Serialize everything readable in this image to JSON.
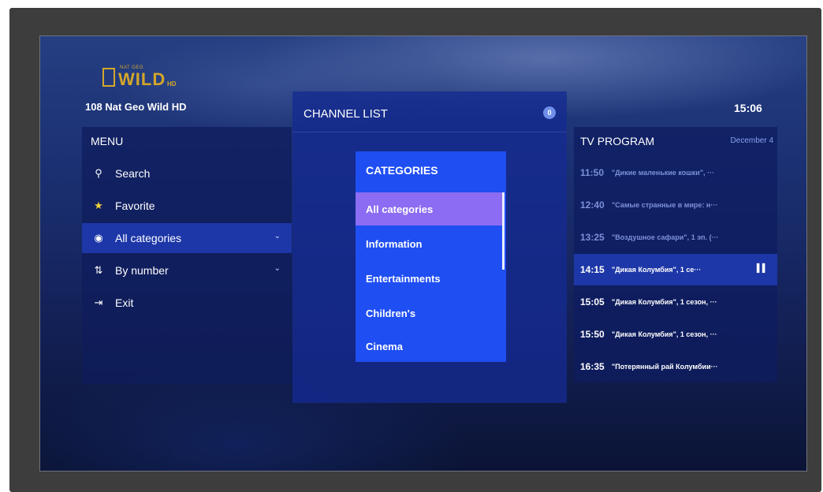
{
  "channel": {
    "number": "108",
    "name": "Nat Geo Wild HD",
    "logo_top": "NAT GEO",
    "logo_main": "WILD",
    "logo_hd": "HD"
  },
  "clock": "15:06",
  "menu": {
    "title": "MENU",
    "items": [
      {
        "label": "Search",
        "icon": "search-icon",
        "glyph": "⚲"
      },
      {
        "label": "Favorite",
        "icon": "star-icon",
        "glyph": "★"
      },
      {
        "label": "All categories",
        "icon": "categories-icon",
        "glyph": "◉"
      },
      {
        "label": "By number",
        "icon": "sort-number-icon",
        "glyph": "⇅"
      },
      {
        "label": "Exit",
        "icon": "exit-icon",
        "glyph": "⇥"
      }
    ],
    "selected_index": 2
  },
  "channel_list": {
    "title": "CHANNEL LIST",
    "badge": "0",
    "categories": {
      "title": "CATEGORIES",
      "items": [
        "All categories",
        "Information",
        "Entertainments",
        "Children's",
        "Cinema"
      ],
      "selected_index": 0
    }
  },
  "tv_program": {
    "title": "TV PROGRAM",
    "date": "December 4",
    "rows": [
      {
        "time": "11:50",
        "title": "\"Дикие маленькие кошки\", ···"
      },
      {
        "time": "12:40",
        "title": "\"Самые странные в мире: н···"
      },
      {
        "time": "13:25",
        "title": "\"Воздушное сафари\", 1 эп. (···"
      },
      {
        "time": "14:15",
        "title": "\"Дикая Колумбия\", 1 се···"
      },
      {
        "time": "15:05",
        "title": "\"Дикая Колумбия\", 1 сезон, ···"
      },
      {
        "time": "15:50",
        "title": "\"Дикая Колумбия\", 1 сезон, ···"
      },
      {
        "time": "16:35",
        "title": "\"Потерянный рай Колумбии···"
      }
    ],
    "current_index": 3
  },
  "colors": {
    "accent": "#1f4ef2",
    "selection": "#8b6cf2",
    "logo": "#d3a62a"
  }
}
